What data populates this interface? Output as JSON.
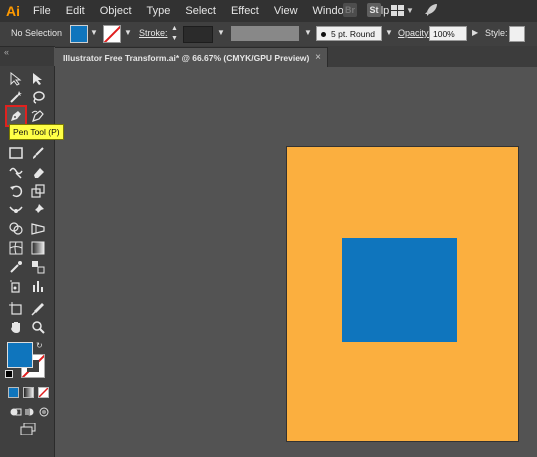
{
  "app": {
    "logo_text": "Ai"
  },
  "menu": {
    "items": [
      "File",
      "Edit",
      "Object",
      "Type",
      "Select",
      "Effect",
      "View",
      "Window",
      "Help"
    ],
    "bridge_label": "Br",
    "stock_label": "St"
  },
  "control_bar": {
    "selection_status": "No Selection",
    "fill_color": "#0f75bd",
    "stroke_label": "Stroke:",
    "brush_value": "5 pt. Round",
    "opacity_label": "Opacity:",
    "opacity_value": "100%",
    "style_label": "Style:"
  },
  "document": {
    "tab_title": "Illustrator Free Transform.ai* @ 66.67% (CMYK/GPU Preview)",
    "close_glyph": "×"
  },
  "tools": {
    "tooltip": "Pen Tool (P)",
    "fill_color": "#0f75bd",
    "stroke_color": "none"
  },
  "artwork": {
    "artboard_color": "#fbaf3f",
    "rectangle_color": "#0f75bd"
  }
}
